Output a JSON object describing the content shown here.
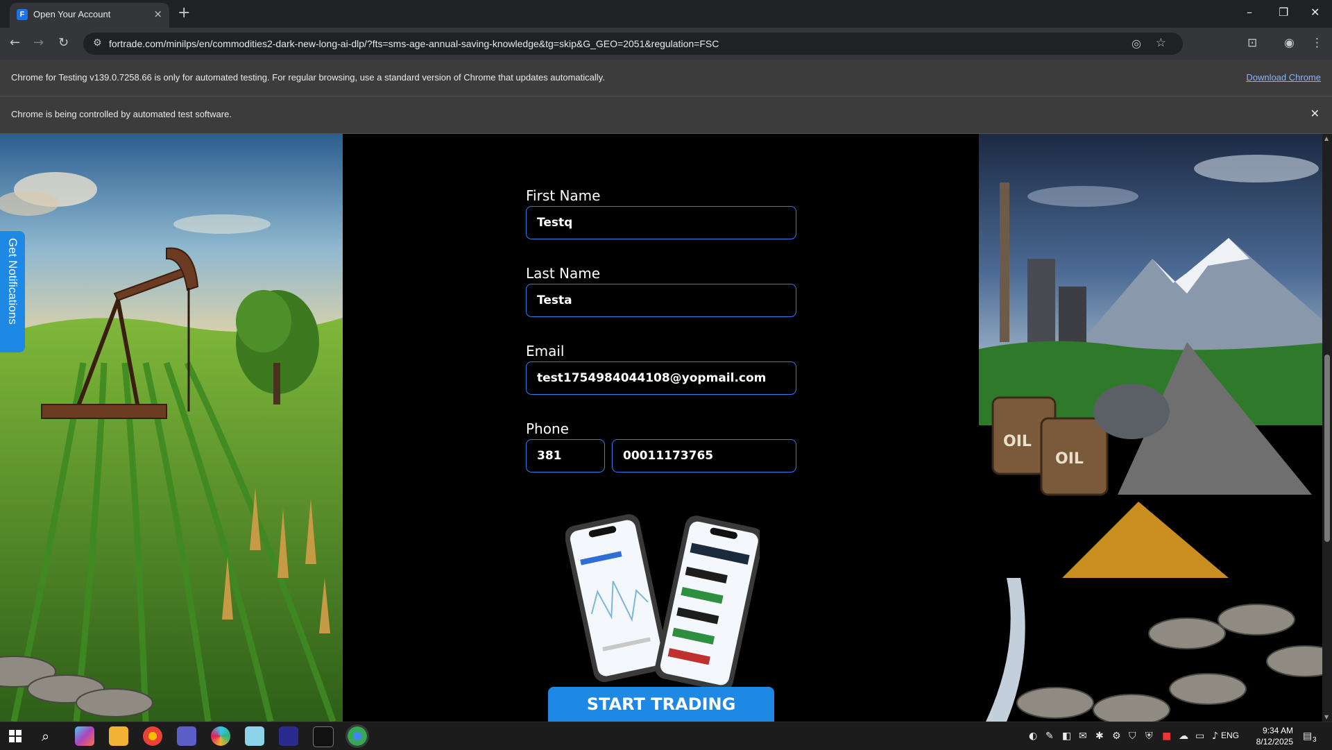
{
  "browser": {
    "tab_title": "Open Your Account",
    "tab_close": "×",
    "new_tab": "+",
    "url": "fortrade.com/minilps/en/commodities2-dark-new-long-ai-dlp/?fts=sms-age-annual-saving-knowledge&tg=skip&G_GEO=2051&regulation=FSC",
    "window_controls": {
      "minimize": "–",
      "restore": "❐",
      "close": "✕"
    },
    "nav": {
      "back": "←",
      "forward": "→",
      "reload": "↻"
    }
  },
  "infobars": {
    "testing_message": "Chrome for Testing v139.0.7258.66 is only for automated testing. For regular browsing, use a standard version of Chrome that updates automatically.",
    "download_link": "Download Chrome",
    "automation_message": "Chrome is being controlled by automated test software.",
    "close": "✕"
  },
  "page": {
    "notifications_tab": "Get Notifications",
    "form": {
      "first_name_label": "First Name",
      "first_name_value": "Testq",
      "last_name_label": "Last Name",
      "last_name_value": "Testa",
      "email_label": "Email",
      "email_value": "test1754984044108@yopmail.com",
      "phone_label": "Phone",
      "phone_code": "381",
      "phone_number": "00011173765"
    },
    "start_button": "START TRADING",
    "barrel_label": "OIL"
  },
  "taskbar": {
    "language": "ENG",
    "time": "9:34 AM",
    "date": "8/12/2025",
    "notification_count": "3"
  },
  "colors": {
    "accent": "#1e88e5",
    "field_border": "#2f7ff0",
    "page_bg": "#000000",
    "chrome_dark": "#202124",
    "chrome_toolbar": "#35363a"
  }
}
